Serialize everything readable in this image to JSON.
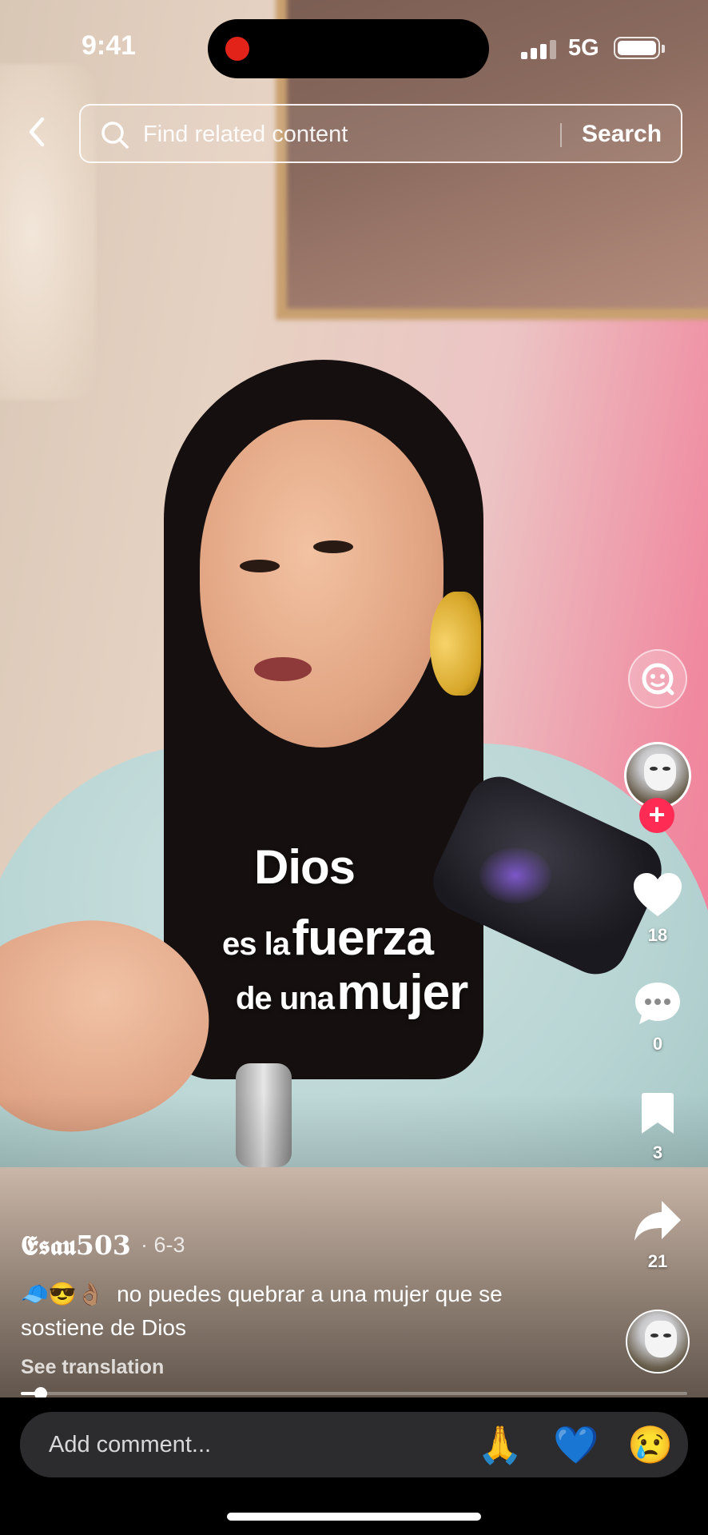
{
  "status_bar": {
    "time": "9:41",
    "network": "5G",
    "battery_level": 1.0
  },
  "search": {
    "placeholder": "Find related content",
    "button_label": "Search"
  },
  "overlay_caption": {
    "line1": "Dios",
    "line2_small": "es la",
    "line2_big": "fuerza",
    "line3_small": "de una",
    "line3_big": "mujer"
  },
  "right_rail": {
    "like_count": "18",
    "comment_count": "0",
    "bookmark_count": "3",
    "share_count": "21"
  },
  "post": {
    "author": "𝕰𝖘𝖆𝖚503",
    "date": "· 6-3",
    "description_emojis": "🧢😎👌🏽",
    "description_text": "no puedes quebrar a una mujer que se sostiene de Dios",
    "see_translation": "See translation",
    "progress": 0.03
  },
  "comment_bar": {
    "placeholder": "Add comment...",
    "quick_emojis": [
      "🙏",
      "💙",
      "😢"
    ]
  },
  "colors": {
    "follow_accent": "#fe2c55",
    "recording_dot": "#e2231a"
  }
}
